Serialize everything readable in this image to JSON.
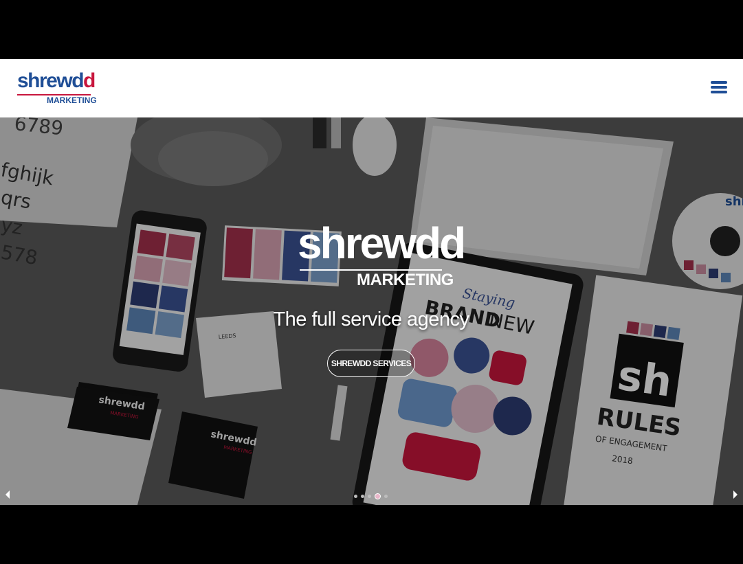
{
  "brand": {
    "logo_word_main": "shrewd",
    "logo_word_accent": "d",
    "logo_sub": "MARKETING",
    "primary_color": "#1f4e96",
    "accent_color": "#c8163d"
  },
  "header": {
    "menu_icon": "hamburger-menu-icon"
  },
  "hero": {
    "logo_word": "shrewdd",
    "logo_sub": "MARKETING",
    "tagline": "The full service agency",
    "cta_label": "SHREWDD SERVICES",
    "prev_icon": "caret-left-icon",
    "next_icon": "caret-right-icon",
    "slide_count": 5,
    "active_slide": 4,
    "scene_text": {
      "digits": "6789",
      "alphabet": [
        "fghijk",
        "qrs",
        "yz",
        "578"
      ],
      "card_brand": "shrewdd",
      "card_sub": "MARKETING",
      "tablet_script": "Staying",
      "tablet_title_a": "BRAND",
      "tablet_title_b": "NEW",
      "book_mark": "sh",
      "book_title": "RULES",
      "book_sub": "OF ENGAGEMENT",
      "book_year": "2018",
      "disc_text": "shr",
      "card_city": "LEEDS"
    }
  }
}
